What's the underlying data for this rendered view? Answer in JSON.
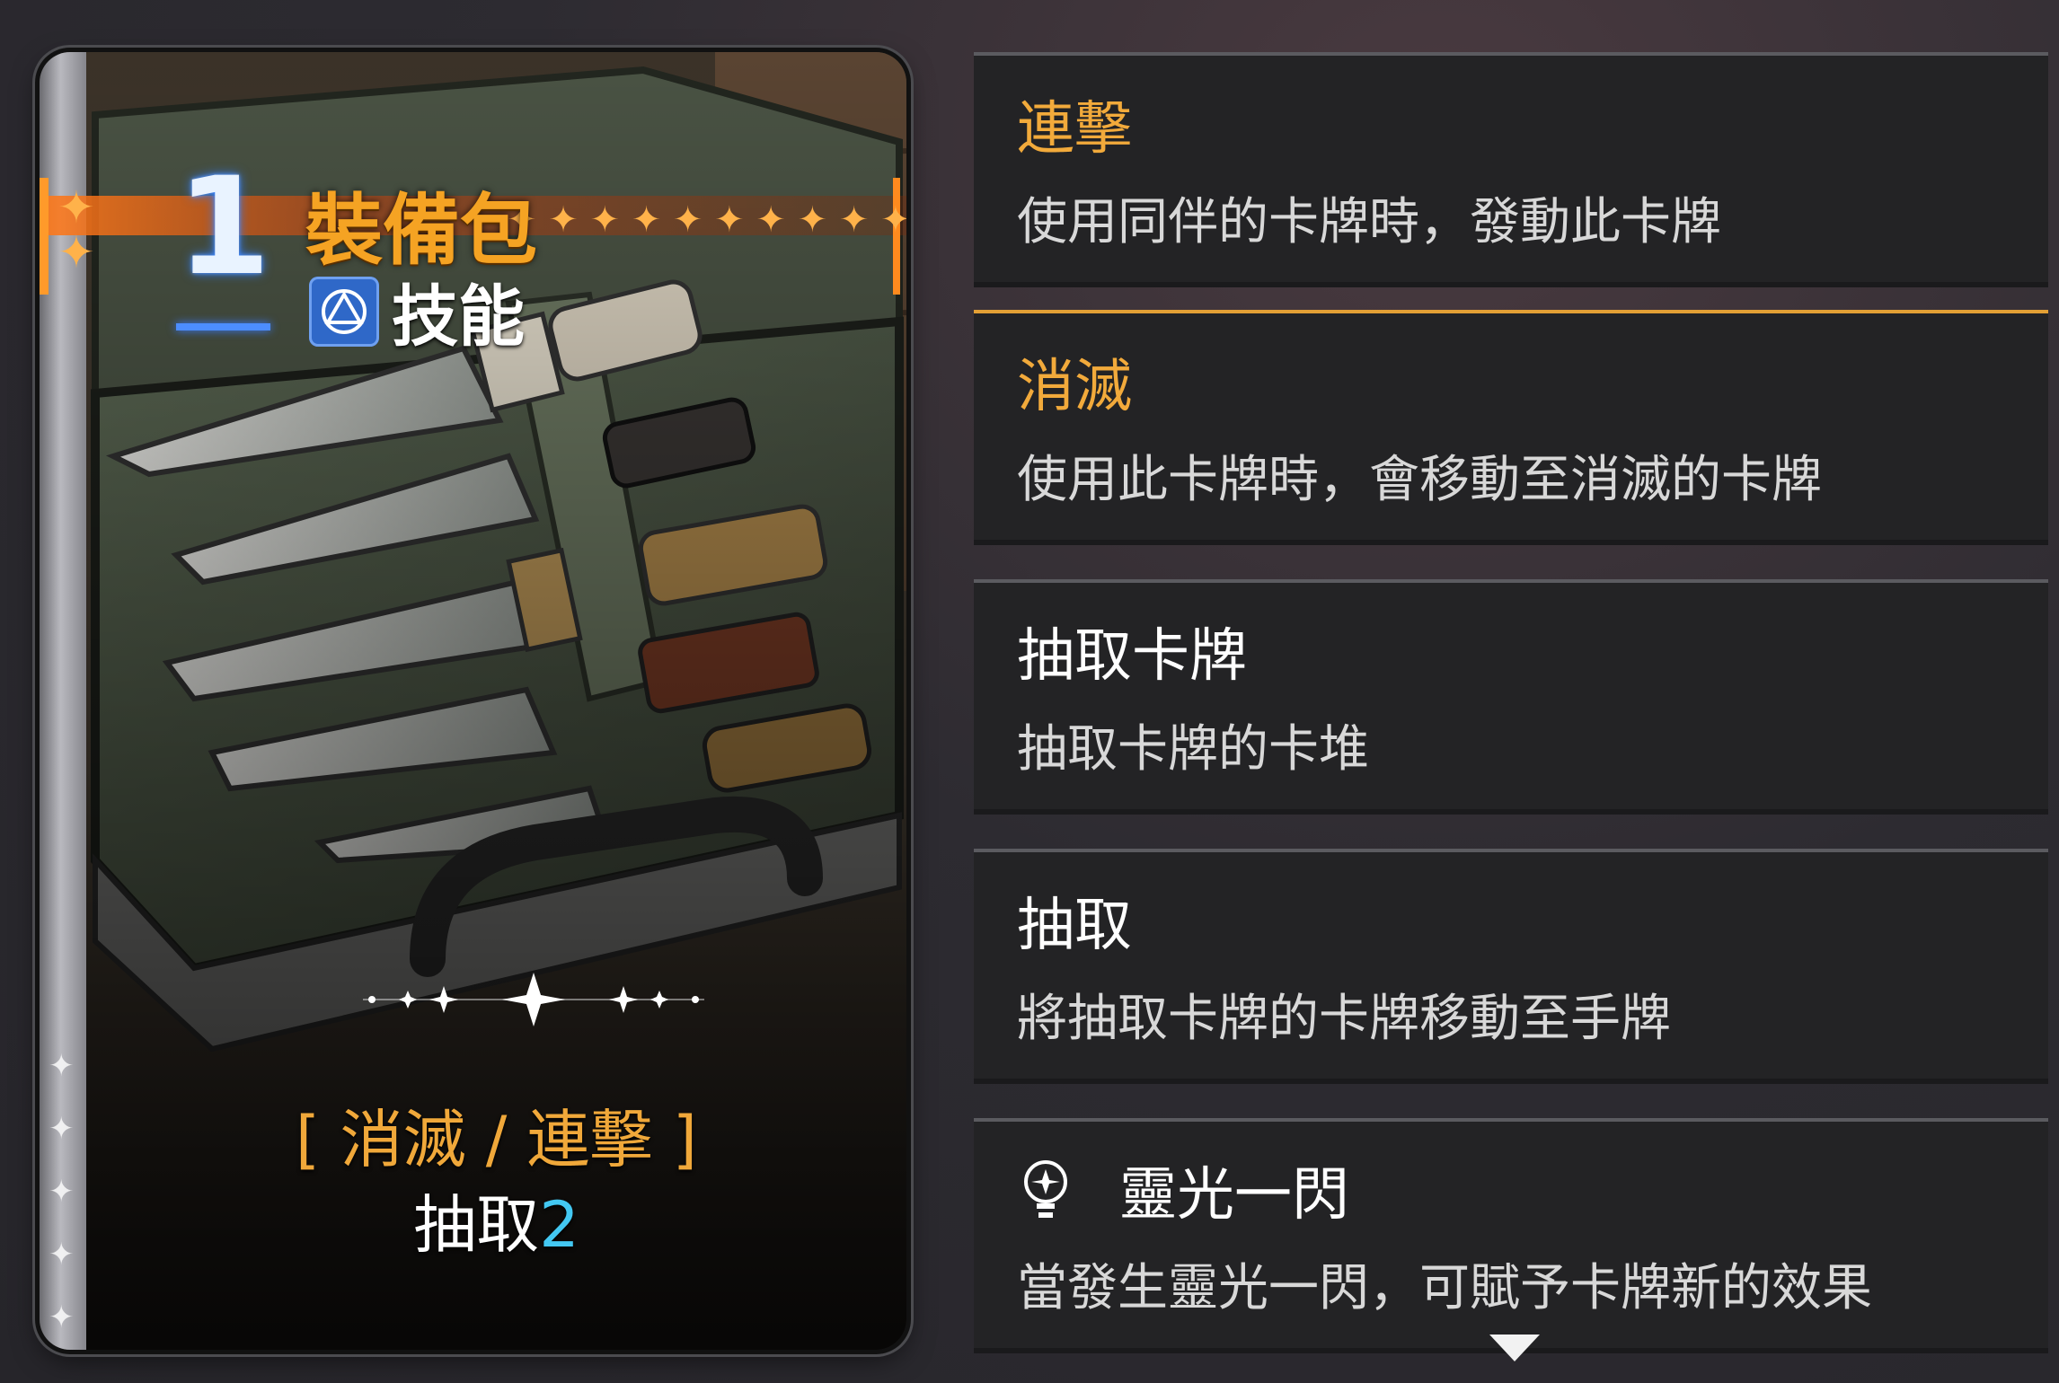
{
  "card": {
    "cost": "1",
    "name": "裝備包",
    "type_label": "技能",
    "type_icon": "skill-triangle-icon",
    "keywords": "[ 消滅 / 連擊 ]",
    "effect_text": "抽取",
    "effect_value": "2"
  },
  "panels": [
    {
      "title": "連擊",
      "desc": "使用同伴的卡牌時，發動此卡牌"
    },
    {
      "title": "消滅",
      "desc": "使用此卡牌時，會移動至消滅的卡牌"
    },
    {
      "title": "抽取卡牌",
      "desc": "抽取卡牌的卡堆"
    },
    {
      "title": "抽取",
      "desc": "將抽取卡牌的卡牌移動至手牌"
    },
    {
      "title": "靈光一閃",
      "desc": "當發生靈光一閃，可賦予卡牌新的效果",
      "icon": "lightbulb-icon"
    }
  ],
  "colors": {
    "accent_orange": "#f2aa3b",
    "cost_blue": "#4c8dff",
    "value_cyan": "#43c8f2"
  }
}
